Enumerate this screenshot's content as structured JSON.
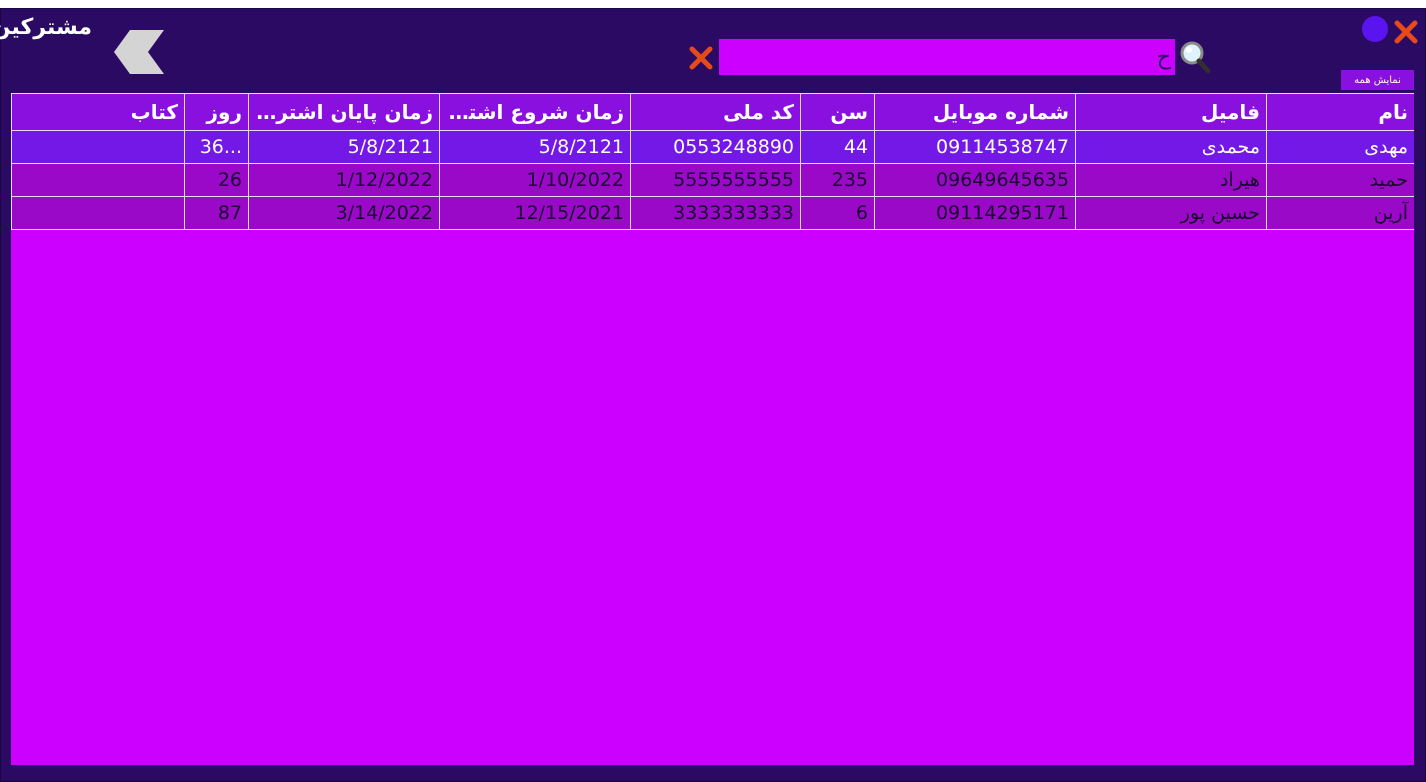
{
  "window": {
    "title": "مشترکین"
  },
  "toolbar": {
    "search_value": "ح",
    "show_all_label": "نمایش همه",
    "icons": {
      "back": "back-arrow-icon",
      "search": "search-icon",
      "clear": "close-icon",
      "close": "close-icon",
      "minimize": "minimize-icon"
    }
  },
  "colors": {
    "window_bg": "#2a0a63",
    "accent": "#cc00ff",
    "header_bg": "#8a10e0",
    "selected_row": "#7418e8",
    "close_red": "#e64a19"
  },
  "table": {
    "columns": [
      "نام",
      "فامیل",
      "شماره موبایل",
      "سن",
      "کد ملی",
      "زمان شروع اشتراک",
      "زمان پایان اشتراک",
      "روز",
      "کتاب"
    ],
    "rows": [
      [
        "مهدی",
        "محمدی",
        "09114538747",
        "44",
        "0553248890",
        "5/8/2121",
        "5/8/2121",
        "36...",
        ""
      ],
      [
        "حمید",
        "هیراد",
        "09649645635",
        "235",
        "5555555555",
        "1/10/2022",
        "1/12/2022",
        "26",
        ""
      ],
      [
        "آرین",
        "حسین پور",
        "09114295171",
        "6",
        "3333333333",
        "12/15/2021",
        "3/14/2022",
        "87",
        ""
      ]
    ]
  }
}
